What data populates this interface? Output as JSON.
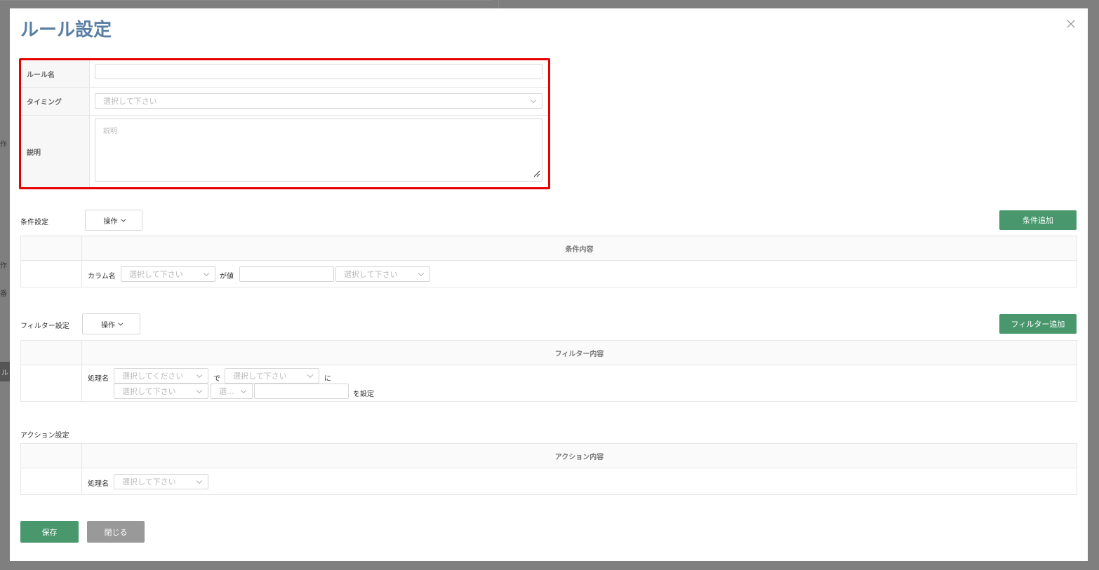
{
  "dialog": {
    "title": "ルール設定",
    "close_icon": "close-icon"
  },
  "basic": {
    "rule_name_label": "ルール名",
    "rule_name_value": "",
    "timing_label": "タイミング",
    "timing_placeholder": "選択して下さい",
    "description_label": "説明",
    "description_placeholder": "説明"
  },
  "condition": {
    "section_label": "条件設定",
    "ops_label": "操作",
    "add_label": "条件追加",
    "header": "条件内容",
    "column_label": "カラム名",
    "column_placeholder": "選択して下さい",
    "value_label": "が値",
    "value_input": "",
    "operator_placeholder": "選択して下さい"
  },
  "filter": {
    "section_label": "フィルター設定",
    "ops_label": "操作",
    "add_label": "フィルター追加",
    "header": "フィルター内容",
    "process_label": "処理名",
    "process_placeholder": "選択してください",
    "de_label": "で",
    "target_placeholder": "選択して下さい",
    "ni_label": "に",
    "field_placeholder": "選択して下さい",
    "short_placeholder": "選...",
    "value_input": "",
    "set_label": "を設定"
  },
  "action": {
    "section_label": "アクション設定",
    "header": "アクション内容",
    "process_label": "処理名",
    "process_placeholder": "選択して下さい"
  },
  "footer": {
    "save_label": "保存",
    "close_label": "閉じる"
  },
  "colors": {
    "title": "#5a7fa5",
    "highlight": "#e60000",
    "green": "#48976d",
    "gray_button": "#999999"
  },
  "background": {
    "side_labels": [
      "作",
      "作",
      "番",
      "ル"
    ]
  }
}
